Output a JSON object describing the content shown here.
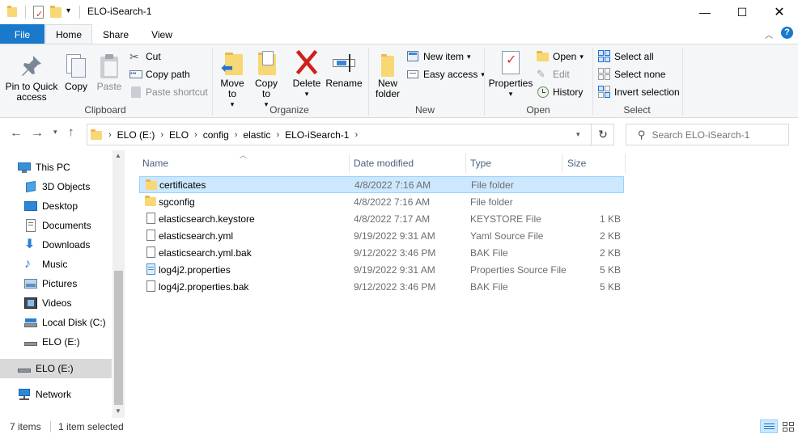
{
  "window": {
    "title": "ELO-iSearch-1"
  },
  "tabs": {
    "file": "File",
    "home": "Home",
    "share": "Share",
    "view": "View"
  },
  "ribbon": {
    "clipboard": {
      "label": "Clipboard",
      "pin": "Pin to Quick access",
      "copy": "Copy",
      "paste": "Paste",
      "cut": "Cut",
      "copy_path": "Copy path",
      "paste_shortcut": "Paste shortcut"
    },
    "organize": {
      "label": "Organize",
      "move_to": "Move to",
      "copy_to": "Copy to",
      "delete": "Delete",
      "rename": "Rename"
    },
    "new": {
      "label": "New",
      "new_folder": "New folder",
      "new_item": "New item",
      "easy_access": "Easy access"
    },
    "open": {
      "label": "Open",
      "properties": "Properties",
      "open": "Open",
      "edit": "Edit",
      "history": "History"
    },
    "select": {
      "label": "Select",
      "select_all": "Select all",
      "select_none": "Select none",
      "invert": "Invert selection"
    }
  },
  "address": {
    "crumbs": [
      "ELO (E:)",
      "ELO",
      "config",
      "elastic",
      "ELO-iSearch-1"
    ],
    "search_placeholder": "Search ELO-iSearch-1"
  },
  "nav": {
    "items": [
      "This PC",
      "3D Objects",
      "Desktop",
      "Documents",
      "Downloads",
      "Music",
      "Pictures",
      "Videos",
      "Local Disk (C:)",
      "ELO (E:)",
      "ELO (E:)",
      "Network"
    ]
  },
  "columns": {
    "name": "Name",
    "date": "Date modified",
    "type": "Type",
    "size": "Size"
  },
  "files": [
    {
      "name": "certificates",
      "date": "4/8/2022 7:16 AM",
      "type": "File folder",
      "size": "",
      "kind": "folder"
    },
    {
      "name": "sgconfig",
      "date": "4/8/2022 7:16 AM",
      "type": "File folder",
      "size": "",
      "kind": "folder"
    },
    {
      "name": "elasticsearch.keystore",
      "date": "4/8/2022 7:17 AM",
      "type": "KEYSTORE File",
      "size": "1 KB",
      "kind": "doc"
    },
    {
      "name": "elasticsearch.yml",
      "date": "9/19/2022 9:31 AM",
      "type": "Yaml Source File",
      "size": "2 KB",
      "kind": "doc"
    },
    {
      "name": "elasticsearch.yml.bak",
      "date": "9/12/2022 3:46 PM",
      "type": "BAK File",
      "size": "2 KB",
      "kind": "doc"
    },
    {
      "name": "log4j2.properties",
      "date": "9/19/2022 9:31 AM",
      "type": "Properties Source File",
      "size": "5 KB",
      "kind": "props"
    },
    {
      "name": "log4j2.properties.bak",
      "date": "9/12/2022 3:46 PM",
      "type": "BAK File",
      "size": "5 KB",
      "kind": "doc"
    }
  ],
  "status": {
    "items": "7 items",
    "selected": "1 item selected"
  },
  "colors": {
    "accent": "#1979ca",
    "selection": "#cce8ff",
    "folder": "#f8d775"
  }
}
